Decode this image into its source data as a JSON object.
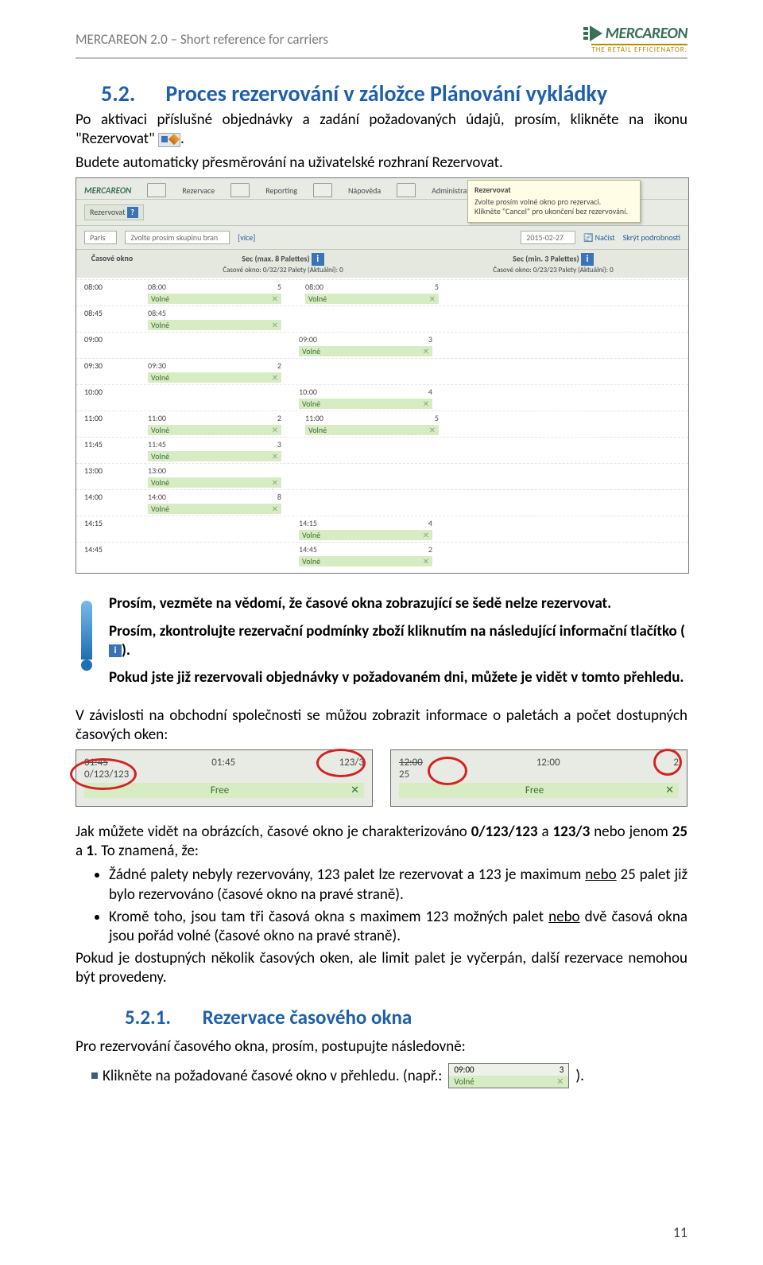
{
  "header": {
    "title": "MERCAREON 2.0 – Short reference for carriers",
    "logo_name": "MERCAREON",
    "logo_tagline": "THE RETAIL EFFICIENATOR."
  },
  "section": {
    "number": "5.2.",
    "title": "Proces rezervování v záložce Plánování vykládky"
  },
  "para1a": "Po aktivaci příslušné objednávky a zadání požadovaných údajů, prosím, klikněte na ikonu \"Rezervovat\"",
  "para1b": ".",
  "para2": "Budete automaticky přesměrování na uživatelské rozhraní Rezervovat.",
  "screenshot1": {
    "menu": [
      "Rezervace",
      "Reporting",
      "Nápověda",
      "Administrativa"
    ],
    "tooltip_title": "Rezervovat",
    "tooltip_l1": "Zvolte prosím volné okno pro rezervaci.",
    "tooltip_l2": "Klikněte \"Cancel\" pro ukončení bez rezervování.",
    "tab": "Rezervovat",
    "filter_ph1": "Paris",
    "filter_ph2": "Zvolte prosím skupinu bran",
    "filter_link": "[více]",
    "filter_date": "2015-02-27",
    "filter_reload": "Načíst",
    "filter_toggle": "Skrýt podrobnosti",
    "col0": "Časové okno",
    "col1": "Sec (max. 8 Palettes)",
    "col1_sub": "Časové okno: 0/32/32 Palety (Aktuální): 0",
    "col2": "Sec (min. 3 Palettes)",
    "col2_sub": "Časové okno: 0/23/23 Palety (Aktuální): 0",
    "free": "Volné",
    "rows": [
      {
        "t": "08:00",
        "a": {
          "t": "08:00",
          "n": "5"
        },
        "b": {
          "t": "08:00",
          "n": "5"
        }
      },
      {
        "t": "08:45",
        "a": {
          "t": "08:45",
          "n": ""
        },
        "b": null
      },
      {
        "t": "09:00",
        "a": null,
        "b": {
          "t": "09:00",
          "n": "3"
        }
      },
      {
        "t": "09:30",
        "a": {
          "t": "09:30",
          "n": "2"
        },
        "b": null
      },
      {
        "t": "10:00",
        "a": null,
        "b": {
          "t": "10:00",
          "n": "4"
        }
      },
      {
        "t": "11:00",
        "a": {
          "t": "11:00",
          "n": "2"
        },
        "b": {
          "t": "11:00",
          "n": "5"
        }
      },
      {
        "t": "11:45",
        "a": {
          "t": "11:45",
          "n": "3"
        },
        "b": null
      },
      {
        "t": "13:00",
        "a": {
          "t": "13:00",
          "n": ""
        },
        "b": null
      },
      {
        "t": "14:00",
        "a": {
          "t": "14:00",
          "n": "8"
        },
        "b": null
      },
      {
        "t": "14:15",
        "a": null,
        "b": {
          "t": "14:15",
          "n": "4"
        }
      },
      {
        "t": "14:45",
        "a": null,
        "b": {
          "t": "14:45",
          "n": "2"
        }
      }
    ]
  },
  "note1": "Prosím, vezměte na vědomí, že časové okna zobrazující se šedě nelze rezervovat.",
  "note2a": "Prosím, zkontrolujte rezervační podmínky zboží kliknutím na následující informační tlačítko (",
  "note2b": ").",
  "note3": "Pokud jste již rezervovali objednávky v požadovaném dni, můžete je vidět v tomto přehledu.",
  "para3": "V závislosti na obchodní společnosti se můžou zobrazit informace o paletách a počet dostupných časových oken:",
  "shot_left": {
    "r1a": "01:45",
    "r1b": "01:45",
    "r1c": "123/3",
    "r2a": "0/123/123",
    "r2b": "Free"
  },
  "shot_right": {
    "r1a": "12:00",
    "r1b": "12:00",
    "r1c": "2",
    "r2a": "25",
    "r2b": "Free"
  },
  "para4a": "Jak můžete vidět na obrázcích, časové okno je charakterizováno ",
  "para4b": "0/123/123",
  "para4c": " a ",
  "para4d": "123/3",
  "para4e": " nebo jenom ",
  "para4f": "25",
  "para4g": " a ",
  "para4h": "1",
  "para4i": ". To znamená, že:",
  "bullet1a": "Žádné palety nebyly rezervovány, 123 palet lze rezervovat a 123 je maximum ",
  "bullet1b": "nebo",
  "bullet1c": " 25 palet již bylo rezervováno (časové okno na pravé straně).",
  "bullet2a": "Kromě toho, jsou tam tři časová okna s maximem 123 možných palet ",
  "bullet2b": "nebo",
  "bullet2c": " dvě časová okna jsou pořád volné (časové okno na pravé straně).",
  "para5": "Pokud je dostupných několik časových oken, ale limit palet je vyčerpán, další rezervace nemohou být provedeny.",
  "subsection": {
    "number": "5.2.1.",
    "title": "Rezervace časového okna"
  },
  "para6": "Pro rezervování časového okna, prosím, postupujte následovně:",
  "step1a": "Klikněte na požadované časové okno v přehledu. (např.: ",
  "step1b": ").",
  "mini": {
    "t": "09:00",
    "n": "3",
    "free": "Volné"
  },
  "page_number": "11"
}
